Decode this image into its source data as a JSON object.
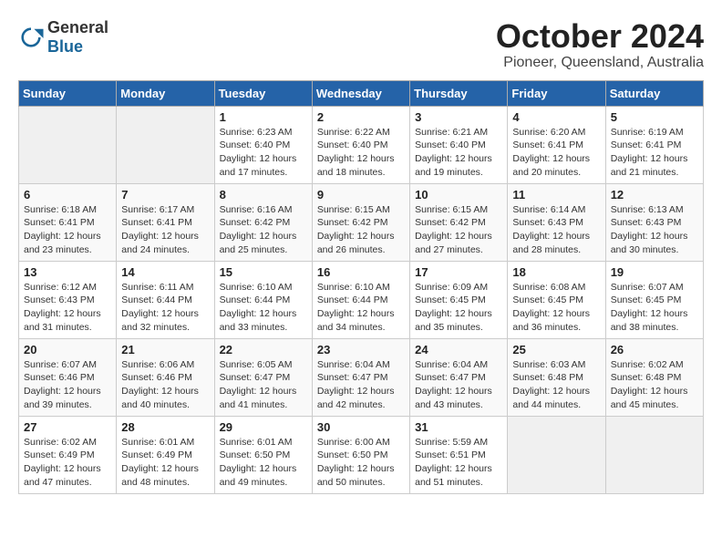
{
  "logo": {
    "general": "General",
    "blue": "Blue"
  },
  "title": "October 2024",
  "location": "Pioneer, Queensland, Australia",
  "days_of_week": [
    "Sunday",
    "Monday",
    "Tuesday",
    "Wednesday",
    "Thursday",
    "Friday",
    "Saturday"
  ],
  "weeks": [
    [
      {
        "day": "",
        "empty": true
      },
      {
        "day": "",
        "empty": true
      },
      {
        "day": "1",
        "sunrise": "Sunrise: 6:23 AM",
        "sunset": "Sunset: 6:40 PM",
        "daylight": "Daylight: 12 hours and 17 minutes."
      },
      {
        "day": "2",
        "sunrise": "Sunrise: 6:22 AM",
        "sunset": "Sunset: 6:40 PM",
        "daylight": "Daylight: 12 hours and 18 minutes."
      },
      {
        "day": "3",
        "sunrise": "Sunrise: 6:21 AM",
        "sunset": "Sunset: 6:40 PM",
        "daylight": "Daylight: 12 hours and 19 minutes."
      },
      {
        "day": "4",
        "sunrise": "Sunrise: 6:20 AM",
        "sunset": "Sunset: 6:41 PM",
        "daylight": "Daylight: 12 hours and 20 minutes."
      },
      {
        "day": "5",
        "sunrise": "Sunrise: 6:19 AM",
        "sunset": "Sunset: 6:41 PM",
        "daylight": "Daylight: 12 hours and 21 minutes."
      }
    ],
    [
      {
        "day": "6",
        "sunrise": "Sunrise: 6:18 AM",
        "sunset": "Sunset: 6:41 PM",
        "daylight": "Daylight: 12 hours and 23 minutes."
      },
      {
        "day": "7",
        "sunrise": "Sunrise: 6:17 AM",
        "sunset": "Sunset: 6:41 PM",
        "daylight": "Daylight: 12 hours and 24 minutes."
      },
      {
        "day": "8",
        "sunrise": "Sunrise: 6:16 AM",
        "sunset": "Sunset: 6:42 PM",
        "daylight": "Daylight: 12 hours and 25 minutes."
      },
      {
        "day": "9",
        "sunrise": "Sunrise: 6:15 AM",
        "sunset": "Sunset: 6:42 PM",
        "daylight": "Daylight: 12 hours and 26 minutes."
      },
      {
        "day": "10",
        "sunrise": "Sunrise: 6:15 AM",
        "sunset": "Sunset: 6:42 PM",
        "daylight": "Daylight: 12 hours and 27 minutes."
      },
      {
        "day": "11",
        "sunrise": "Sunrise: 6:14 AM",
        "sunset": "Sunset: 6:43 PM",
        "daylight": "Daylight: 12 hours and 28 minutes."
      },
      {
        "day": "12",
        "sunrise": "Sunrise: 6:13 AM",
        "sunset": "Sunset: 6:43 PM",
        "daylight": "Daylight: 12 hours and 30 minutes."
      }
    ],
    [
      {
        "day": "13",
        "sunrise": "Sunrise: 6:12 AM",
        "sunset": "Sunset: 6:43 PM",
        "daylight": "Daylight: 12 hours and 31 minutes."
      },
      {
        "day": "14",
        "sunrise": "Sunrise: 6:11 AM",
        "sunset": "Sunset: 6:44 PM",
        "daylight": "Daylight: 12 hours and 32 minutes."
      },
      {
        "day": "15",
        "sunrise": "Sunrise: 6:10 AM",
        "sunset": "Sunset: 6:44 PM",
        "daylight": "Daylight: 12 hours and 33 minutes."
      },
      {
        "day": "16",
        "sunrise": "Sunrise: 6:10 AM",
        "sunset": "Sunset: 6:44 PM",
        "daylight": "Daylight: 12 hours and 34 minutes."
      },
      {
        "day": "17",
        "sunrise": "Sunrise: 6:09 AM",
        "sunset": "Sunset: 6:45 PM",
        "daylight": "Daylight: 12 hours and 35 minutes."
      },
      {
        "day": "18",
        "sunrise": "Sunrise: 6:08 AM",
        "sunset": "Sunset: 6:45 PM",
        "daylight": "Daylight: 12 hours and 36 minutes."
      },
      {
        "day": "19",
        "sunrise": "Sunrise: 6:07 AM",
        "sunset": "Sunset: 6:45 PM",
        "daylight": "Daylight: 12 hours and 38 minutes."
      }
    ],
    [
      {
        "day": "20",
        "sunrise": "Sunrise: 6:07 AM",
        "sunset": "Sunset: 6:46 PM",
        "daylight": "Daylight: 12 hours and 39 minutes."
      },
      {
        "day": "21",
        "sunrise": "Sunrise: 6:06 AM",
        "sunset": "Sunset: 6:46 PM",
        "daylight": "Daylight: 12 hours and 40 minutes."
      },
      {
        "day": "22",
        "sunrise": "Sunrise: 6:05 AM",
        "sunset": "Sunset: 6:47 PM",
        "daylight": "Daylight: 12 hours and 41 minutes."
      },
      {
        "day": "23",
        "sunrise": "Sunrise: 6:04 AM",
        "sunset": "Sunset: 6:47 PM",
        "daylight": "Daylight: 12 hours and 42 minutes."
      },
      {
        "day": "24",
        "sunrise": "Sunrise: 6:04 AM",
        "sunset": "Sunset: 6:47 PM",
        "daylight": "Daylight: 12 hours and 43 minutes."
      },
      {
        "day": "25",
        "sunrise": "Sunrise: 6:03 AM",
        "sunset": "Sunset: 6:48 PM",
        "daylight": "Daylight: 12 hours and 44 minutes."
      },
      {
        "day": "26",
        "sunrise": "Sunrise: 6:02 AM",
        "sunset": "Sunset: 6:48 PM",
        "daylight": "Daylight: 12 hours and 45 minutes."
      }
    ],
    [
      {
        "day": "27",
        "sunrise": "Sunrise: 6:02 AM",
        "sunset": "Sunset: 6:49 PM",
        "daylight": "Daylight: 12 hours and 47 minutes."
      },
      {
        "day": "28",
        "sunrise": "Sunrise: 6:01 AM",
        "sunset": "Sunset: 6:49 PM",
        "daylight": "Daylight: 12 hours and 48 minutes."
      },
      {
        "day": "29",
        "sunrise": "Sunrise: 6:01 AM",
        "sunset": "Sunset: 6:50 PM",
        "daylight": "Daylight: 12 hours and 49 minutes."
      },
      {
        "day": "30",
        "sunrise": "Sunrise: 6:00 AM",
        "sunset": "Sunset: 6:50 PM",
        "daylight": "Daylight: 12 hours and 50 minutes."
      },
      {
        "day": "31",
        "sunrise": "Sunrise: 5:59 AM",
        "sunset": "Sunset: 6:51 PM",
        "daylight": "Daylight: 12 hours and 51 minutes."
      },
      {
        "day": "",
        "empty": true
      },
      {
        "day": "",
        "empty": true
      }
    ]
  ]
}
